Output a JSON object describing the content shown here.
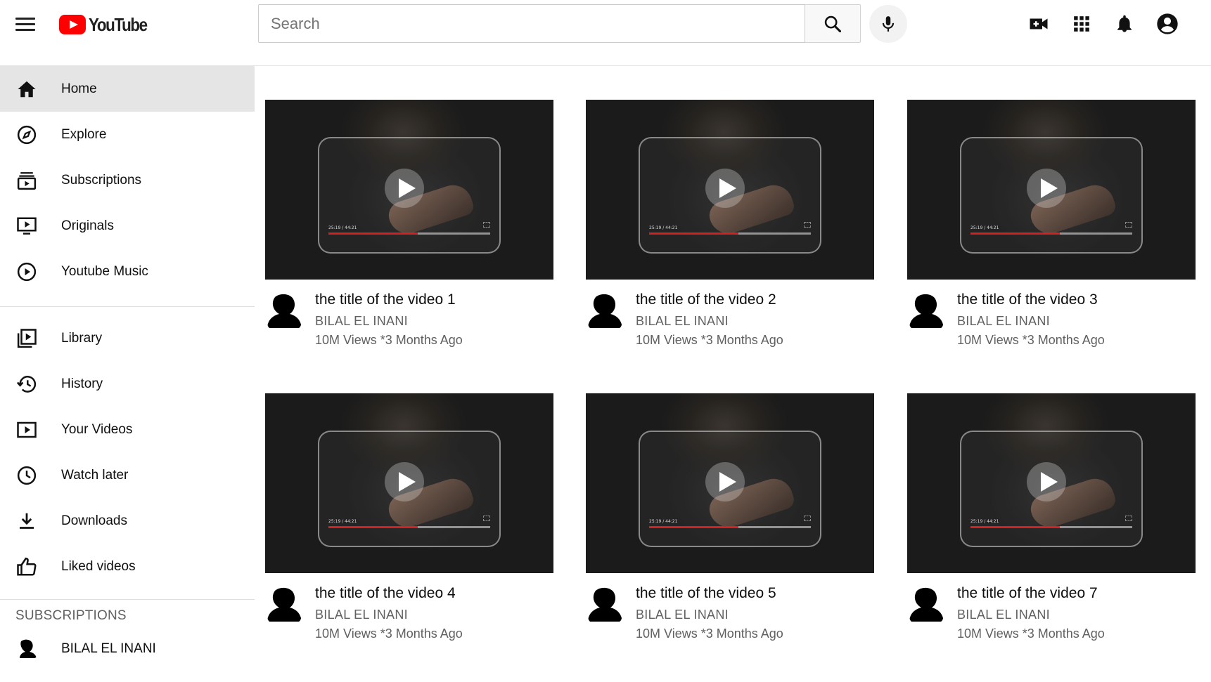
{
  "header": {
    "logo_text": "YouTube",
    "search_placeholder": "Search",
    "icons": [
      "menu-icon",
      "search-icon",
      "mic-icon",
      "create-video-icon",
      "apps-grid-icon",
      "notifications-bell-icon",
      "account-icon"
    ]
  },
  "sidebar": {
    "main_items": [
      {
        "label": "Home",
        "icon": "home-icon",
        "active": true
      },
      {
        "label": "Explore",
        "icon": "compass-icon"
      },
      {
        "label": "Subscriptions",
        "icon": "subscriptions-icon"
      },
      {
        "label": "Originals",
        "icon": "originals-icon"
      },
      {
        "label": "Youtube Music",
        "icon": "play-circle-icon"
      }
    ],
    "library_items": [
      {
        "label": "Library",
        "icon": "library-icon"
      },
      {
        "label": "History",
        "icon": "history-icon"
      },
      {
        "label": "Your Videos",
        "icon": "your-videos-icon"
      },
      {
        "label": "Watch later",
        "icon": "clock-icon"
      },
      {
        "label": "Downloads",
        "icon": "download-icon"
      },
      {
        "label": "Liked videos",
        "icon": "thumbs-up-icon"
      }
    ],
    "subscriptions_title": "SUBSCRIPTIONS",
    "subscriptions": [
      {
        "name": "BILAL EL INANI"
      }
    ]
  },
  "videos": [
    {
      "title": "the title of the video 1",
      "channel": "BILAL EL INANI",
      "stats": "10M Views *3 Months Ago",
      "thumb_time": "25:19 / 44:21",
      "progress": 0.55
    },
    {
      "title": "the title of the video 2",
      "channel": "BILAL EL INANI",
      "stats": "10M Views *3 Months Ago",
      "thumb_time": "25:19 / 44:21",
      "progress": 0.55
    },
    {
      "title": "the title of the video 3",
      "channel": "BILAL EL INANI",
      "stats": "10M Views *3 Months Ago",
      "thumb_time": "25:19 / 44:21",
      "progress": 0.55
    },
    {
      "title": "the title of the video 4",
      "channel": "BILAL EL INANI",
      "stats": "10M Views *3 Months Ago",
      "thumb_time": "25:19 / 44:21",
      "progress": 0.55
    },
    {
      "title": "the title of the video 5",
      "channel": "BILAL EL INANI",
      "stats": "10M Views *3 Months Ago",
      "thumb_time": "25:19 / 44:21",
      "progress": 0.55
    },
    {
      "title": "the title of the video 7",
      "channel": "BILAL EL INANI",
      "stats": "10M Views *3 Months Ago",
      "thumb_time": "25:19 / 44:21",
      "progress": 0.55
    }
  ],
  "colors": {
    "brand_red": "#ff0000",
    "active_item_bg": "#e5e5e5",
    "secondary_text": "#606060",
    "progress_red": "#d32020"
  }
}
